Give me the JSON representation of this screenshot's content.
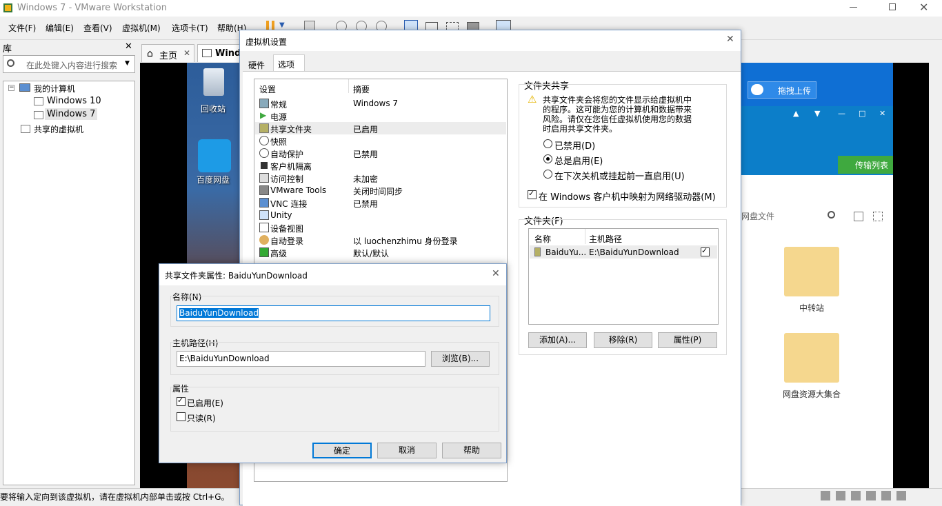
{
  "window": {
    "title": "Windows 7 - VMware Workstation"
  },
  "menu": [
    "文件(F)",
    "编辑(E)",
    "查看(V)",
    "虚拟机(M)",
    "选项卡(T)",
    "帮助(H)"
  ],
  "library": {
    "title": "库",
    "search_placeholder": "在此处键入内容进行搜索",
    "tree": {
      "my_computer": "我的计算机",
      "vm1": "Windows 10",
      "vm2": "Windows 7",
      "shared": "共享的虚拟机"
    }
  },
  "tabs": {
    "home": "主页",
    "vm": "Windo"
  },
  "guest": {
    "recycle_bin": "回收站",
    "baidu_pan": "百度网盘",
    "upload_btn": "拖拽上传",
    "transfer_list": "传输列表",
    "search_placeholder": "网盘文件",
    "folders": [
      "中转站",
      "网盘资源大集合"
    ]
  },
  "settings": {
    "title": "虚拟机设置",
    "tabs": [
      "硬件",
      "选项"
    ],
    "col_setting": "设置",
    "col_summary": "摘要",
    "rows": [
      {
        "name": "常规",
        "value": "Windows 7",
        "icon": "general-icon"
      },
      {
        "name": "电源",
        "value": "",
        "icon": "power-icon"
      },
      {
        "name": "共享文件夹",
        "value": "已启用",
        "icon": "shared-folder-icon"
      },
      {
        "name": "快照",
        "value": "",
        "icon": "snapshot-icon"
      },
      {
        "name": "自动保护",
        "value": "已禁用",
        "icon": "autoprotect-icon"
      },
      {
        "name": "客户机隔离",
        "value": "",
        "icon": "lock-icon"
      },
      {
        "name": "访问控制",
        "value": "未加密",
        "icon": "access-control-icon"
      },
      {
        "name": "VMware Tools",
        "value": "关闭时间同步",
        "icon": "vmware-tools-icon"
      },
      {
        "name": "VNC 连接",
        "value": "已禁用",
        "icon": "vnc-icon"
      },
      {
        "name": "Unity",
        "value": "",
        "icon": "unity-icon"
      },
      {
        "name": "设备视图",
        "value": "",
        "icon": "device-view-icon"
      },
      {
        "name": "自动登录",
        "value": "以 luochenzhimu 身份登录",
        "icon": "autologin-icon"
      },
      {
        "name": "高级",
        "value": "默认/默认",
        "icon": "advanced-icon"
      }
    ],
    "folder_sharing": {
      "title": "文件夹共享",
      "warning": [
        "共享文件夹会将您的文件显示给虚拟机中",
        "的程序。这可能为您的计算机和数据带来",
        "风险。请仅在您信任虚拟机使用您的数据",
        "时启用共享文件夹。"
      ],
      "options": [
        "已禁用(D)",
        "总是启用(E)",
        "在下次关机或挂起前一直启用(U)"
      ],
      "selected": 1,
      "map_drive": "在 Windows 客户机中映射为网络驱动器(M)"
    },
    "folders": {
      "title": "文件夹(F)",
      "col_name": "名称",
      "col_path": "主机路径",
      "rows": [
        {
          "name": "BaiduYu...",
          "path": "E:\\BaiduYunDownload",
          "checked": true
        }
      ],
      "add": "添加(A)...",
      "remove": "移除(R)",
      "properties": "属性(P)"
    }
  },
  "props_dialog": {
    "title": "共享文件夹属性: BaiduYunDownload",
    "name_label": "名称(N)",
    "name_value": "BaiduYunDownload",
    "path_label": "主机路径(H)",
    "path_value": "E:\\BaiduYunDownload",
    "browse": "浏览(B)...",
    "attrs_label": "属性",
    "enabled": "已启用(E)",
    "readonly": "只读(R)",
    "ok": "确定",
    "cancel": "取消",
    "help": "帮助"
  },
  "statusbar": {
    "text": "要将输入定向到该虚拟机，请在虚拟机内部单击或按 Ctrl+G。"
  },
  "colors": {
    "accent": "#0078d7",
    "baidu_blue": "#0f6fd4",
    "green": "#3fa93f"
  }
}
